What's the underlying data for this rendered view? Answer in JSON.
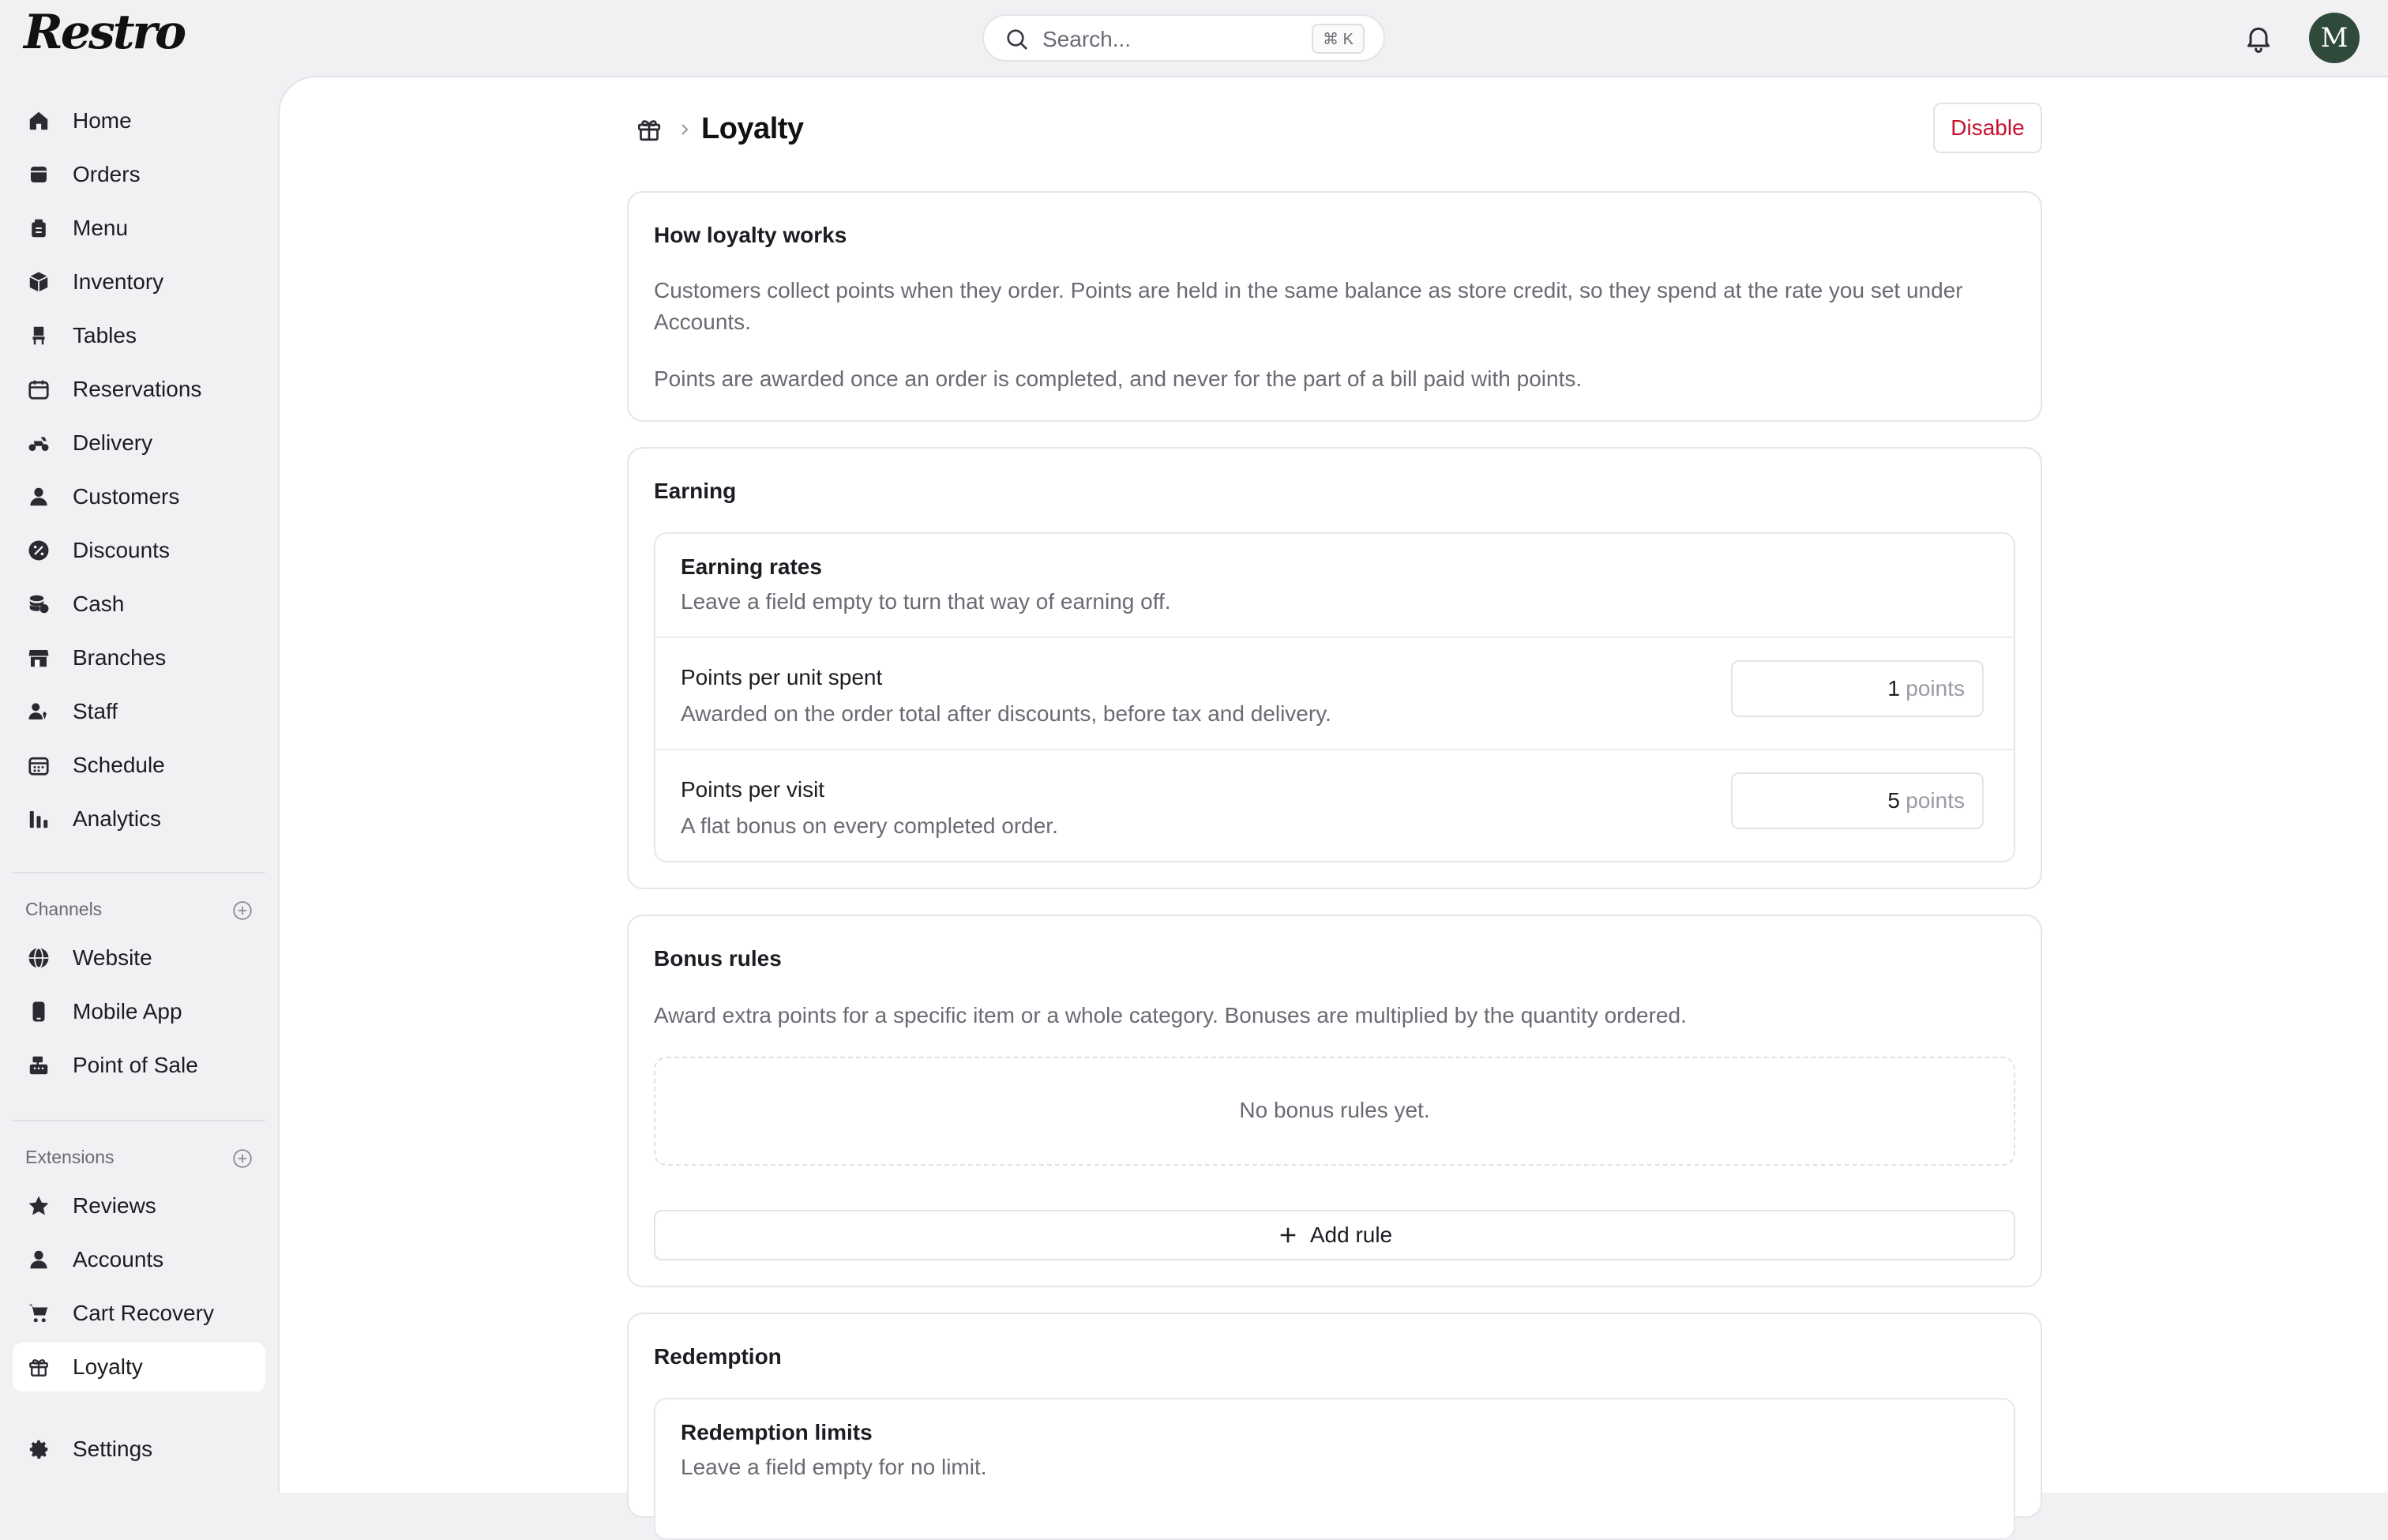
{
  "header": {
    "logo": "Restro",
    "search_placeholder": "Search...",
    "search_shortcut": "⌘ K",
    "avatar_initial": "M"
  },
  "sidebar": {
    "main_items": [
      {
        "label": "Home",
        "icon": "home-icon"
      },
      {
        "label": "Orders",
        "icon": "orders-icon"
      },
      {
        "label": "Menu",
        "icon": "menu-icon"
      },
      {
        "label": "Inventory",
        "icon": "inventory-icon"
      },
      {
        "label": "Tables",
        "icon": "chair-icon"
      },
      {
        "label": "Reservations",
        "icon": "calendar-icon"
      },
      {
        "label": "Delivery",
        "icon": "scooter-icon"
      },
      {
        "label": "Customers",
        "icon": "user-icon"
      },
      {
        "label": "Discounts",
        "icon": "discount-icon"
      },
      {
        "label": "Cash",
        "icon": "coins-icon"
      },
      {
        "label": "Branches",
        "icon": "store-icon"
      },
      {
        "label": "Staff",
        "icon": "staff-icon"
      },
      {
        "label": "Schedule",
        "icon": "schedule-icon"
      },
      {
        "label": "Analytics",
        "icon": "chart-icon"
      }
    ],
    "channels_label": "Channels",
    "channels": [
      {
        "label": "Website",
        "icon": "globe-icon"
      },
      {
        "label": "Mobile App",
        "icon": "phone-icon"
      },
      {
        "label": "Point of Sale",
        "icon": "register-icon"
      }
    ],
    "extensions_label": "Extensions",
    "extensions": [
      {
        "label": "Reviews",
        "icon": "star-icon"
      },
      {
        "label": "Accounts",
        "icon": "user-icon"
      },
      {
        "label": "Cart Recovery",
        "icon": "cart-icon"
      },
      {
        "label": "Loyalty",
        "icon": "gift-icon",
        "active": true
      }
    ],
    "settings_label": "Settings"
  },
  "page": {
    "title": "Loyalty",
    "disable_label": "Disable"
  },
  "how": {
    "title": "How loyalty works",
    "para1": "Customers collect points when they order. Points are held in the same balance as store credit, so they spend at the rate you set under Accounts.",
    "para2": "Points are awarded once an order is completed, and never for the part of a bill paid with points."
  },
  "earning": {
    "title": "Earning",
    "rates_title": "Earning rates",
    "rates_desc": "Leave a field empty to turn that way of earning off.",
    "per_unit_title": "Points per unit spent",
    "per_unit_desc": "Awarded on the order total after discounts, before tax and delivery.",
    "per_unit_value": "1",
    "per_visit_title": "Points per visit",
    "per_visit_desc": "A flat bonus on every completed order.",
    "per_visit_value": "5",
    "unit": "points"
  },
  "bonus": {
    "title": "Bonus rules",
    "desc": "Award extra points for a specific item or a whole category. Bonuses are multiplied by the quantity ordered.",
    "empty": "No bonus rules yet.",
    "add_label": "Add rule"
  },
  "redemption": {
    "title": "Redemption",
    "limits_title": "Redemption limits",
    "limits_desc": "Leave a field empty for no limit."
  }
}
